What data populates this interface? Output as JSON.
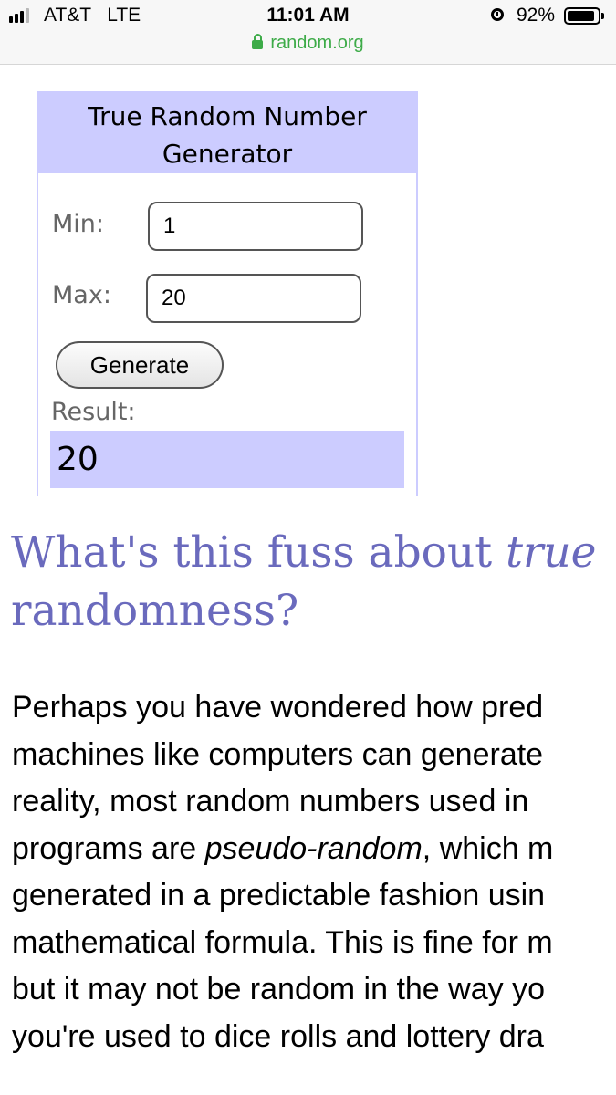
{
  "status_bar": {
    "carrier": "AT&T   LTE",
    "time": "11:01 AM",
    "url": "random.org",
    "battery_percent": "92%",
    "battery_level": 0.92,
    "signal_bars_active": 3,
    "signal_bars_total": 4
  },
  "generator": {
    "title": "True Random Number Generator",
    "min_label": "Min:",
    "min_value": "1",
    "max_label": "Max:",
    "max_value": "20",
    "generate_label": "Generate",
    "result_label": "Result:",
    "result_value": "20"
  },
  "article": {
    "heading_prefix": "What's this fuss about ",
    "heading_emphasis": "true",
    "heading_suffix": "randomness?",
    "paragraph_lines": [
      {
        "text": "Perhaps you have wondered how pred"
      },
      {
        "text": "machines like computers can generate"
      },
      {
        "text": "reality, most random numbers used in"
      },
      {
        "before": "programs are ",
        "emphasis": "pseudo-random",
        "after": ", which m"
      },
      {
        "text": "generated in a predictable fashion usin"
      },
      {
        "text": "mathematical formula. This is fine for m"
      },
      {
        "text": "but it may not be random in the way yo"
      },
      {
        "text": "you're used to dice rolls and lottery dra"
      }
    ]
  },
  "colors": {
    "accent_lavender": "#ccccff",
    "heading": "#6a6abd",
    "secure_green": "#3dab48"
  }
}
